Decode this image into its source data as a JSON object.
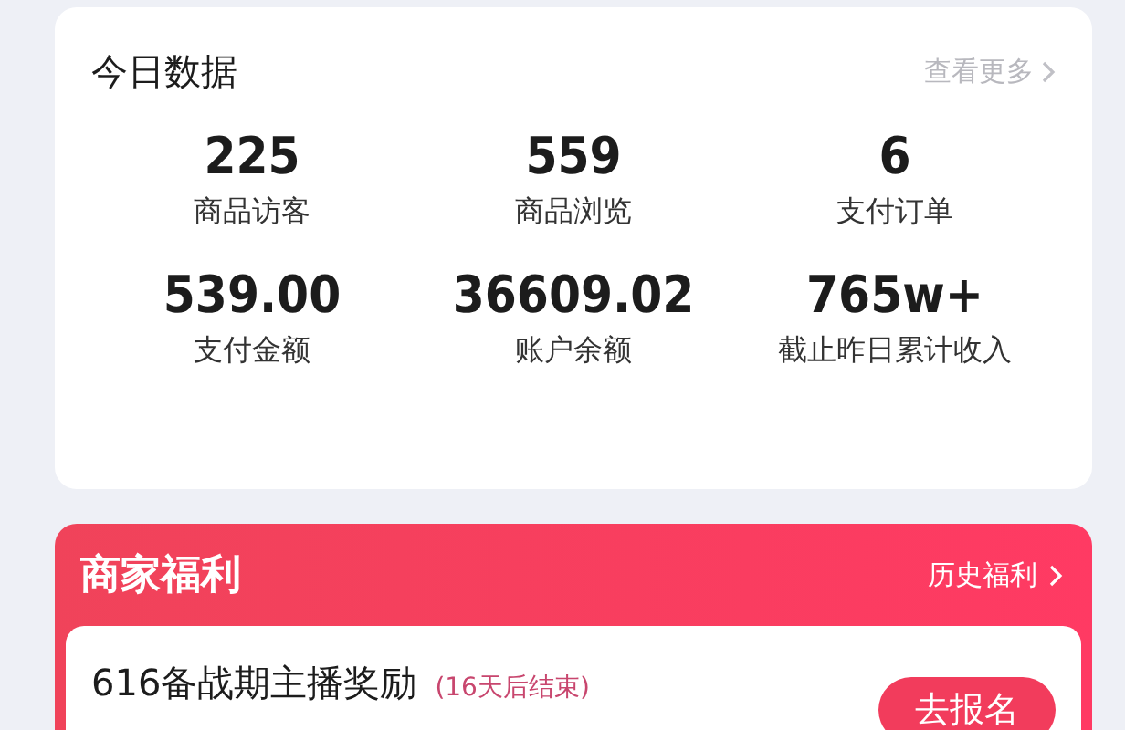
{
  "today_data": {
    "title": "今日数据",
    "more_link": "查看更多",
    "stats": [
      {
        "value": "225",
        "label": "商品访客"
      },
      {
        "value": "559",
        "label": "商品浏览"
      },
      {
        "value": "6",
        "label": "支付订单"
      },
      {
        "value": "539.00",
        "label": "支付金额"
      },
      {
        "value": "36609.02",
        "label": "账户余额"
      },
      {
        "value": "765w+",
        "label": "截止昨日累计收入"
      }
    ]
  },
  "merchant_benefits": {
    "title": "商家福利",
    "history_link": "历史福利",
    "tasks": [
      {
        "title": "616备战期主播奖励",
        "countdown": "(16天后结束)",
        "button": "去报名"
      }
    ]
  }
}
